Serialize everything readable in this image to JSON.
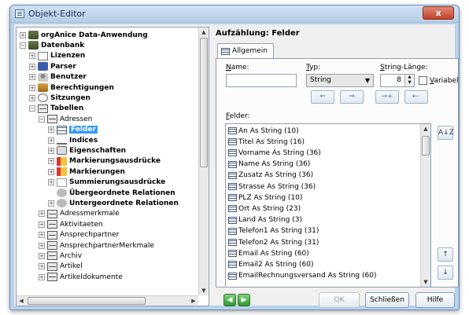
{
  "window": {
    "title": "Objekt-Editor",
    "close": "x"
  },
  "tree": {
    "items": [
      {
        "label": "orgAnice Data-Anwendung",
        "exp": "+",
        "icon": "database-icon",
        "bold": true
      },
      {
        "label": "Datenbank",
        "exp": "−",
        "icon": "database-icon",
        "bold": true
      },
      {
        "label": "Lizenzen",
        "exp": "+",
        "icon": "paragraph-icon",
        "bold": true
      },
      {
        "label": "Parser",
        "exp": "+",
        "icon": "parser-icon",
        "bold": true
      },
      {
        "label": "Benutzer",
        "exp": "+",
        "icon": "user-icon",
        "bold": true
      },
      {
        "label": "Berechtigungen",
        "exp": "+",
        "icon": "key-icon",
        "bold": true
      },
      {
        "label": "Sitzungen",
        "exp": "+",
        "icon": "clock-icon",
        "bold": true
      },
      {
        "label": "Tabellen",
        "exp": "−",
        "icon": "folder-icon",
        "bold": true
      },
      {
        "label": "Adressen",
        "exp": "−",
        "icon": "folder-icon",
        "bold": false
      },
      {
        "label": "Felder",
        "exp": "+",
        "icon": "table-icon",
        "bold": true,
        "selected": true
      },
      {
        "label": "Indices",
        "exp": "+",
        "icon": "index-icon",
        "bold": true
      },
      {
        "label": "Eigenschaften",
        "exp": "+",
        "icon": "properties-icon",
        "bold": true
      },
      {
        "label": "Markierungsausdrücke",
        "exp": "+",
        "icon": "marker-icon",
        "bold": true
      },
      {
        "label": "Markierungen",
        "exp": "+",
        "icon": "marker-icon",
        "bold": true
      },
      {
        "label": "Summierungsausdrücke",
        "exp": "+",
        "icon": "sum-icon",
        "bold": true
      },
      {
        "label": "Übergeordnete Relationen",
        "exp": "",
        "icon": "relation-icon",
        "bold": true
      },
      {
        "label": "Untergeordnete Relationen",
        "exp": "+",
        "icon": "relation-icon",
        "bold": true
      },
      {
        "label": "Adressmerkmale",
        "exp": "+",
        "icon": "folder-icon",
        "bold": false
      },
      {
        "label": "Aktivitaeten",
        "exp": "+",
        "icon": "folder-icon",
        "bold": false
      },
      {
        "label": "Ansprechpartner",
        "exp": "+",
        "icon": "folder-icon",
        "bold": false
      },
      {
        "label": "AnsprechpartnerMerkmale",
        "exp": "+",
        "icon": "folder-icon",
        "bold": false
      },
      {
        "label": "Archiv",
        "exp": "+",
        "icon": "folder-icon",
        "bold": false
      },
      {
        "label": "Artikel",
        "exp": "+",
        "icon": "folder-icon",
        "bold": false
      },
      {
        "label": "Artikeldokumente",
        "exp": "+",
        "icon": "folder-icon",
        "bold": false
      }
    ]
  },
  "panel": {
    "header": "Aufzählung: Felder",
    "tab": "Allgemein",
    "name_label_u": "N",
    "name_label_rest": "ame:",
    "name_value": "",
    "type_label_u": "T",
    "type_label_rest": "yp:",
    "type_value": "String",
    "strlen_label_u": "S",
    "strlen_label_rest": "tring-Länge:",
    "strlen_value": "8",
    "variable_label_u": "V",
    "variable_label_rest": "ariabel",
    "fields_label_u": "F",
    "fields_label_rest": "elder:",
    "arrow_buttons": [
      "⇐",
      "⇒",
      "→+",
      "←·"
    ],
    "fields": [
      "An As String (10)",
      "Titel As String (16)",
      "Vorname As String (36)",
      "Name As String (36)",
      "Zusatz As String (36)",
      "Strasse As String (36)",
      "PLZ As String (10)",
      "Ort As String (23)",
      "Land As String (3)",
      "Telefon1 As String (31)",
      "Telefon2 As String (31)",
      "Email As String (60)",
      "Email2 As String (60)",
      "EmailRechnungsversand As String (60)"
    ],
    "sort_button": "A↓Z",
    "up_button": "↑",
    "down_button": "↓"
  },
  "footer": {
    "prev": "◀",
    "next": "▶",
    "ok": "OK",
    "close": "Schließen",
    "help": "Hilfe"
  }
}
